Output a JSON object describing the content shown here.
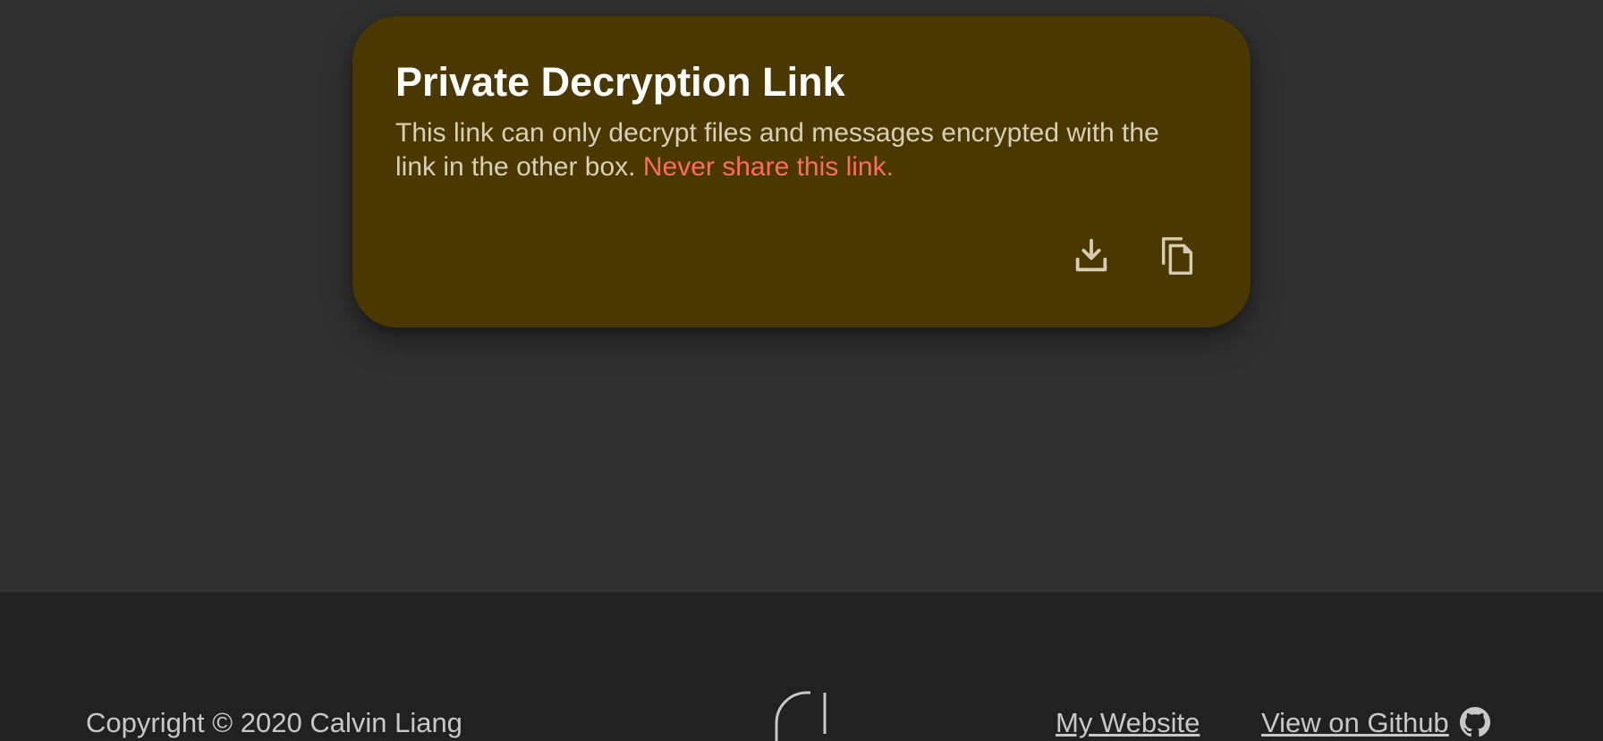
{
  "colors": {
    "page_background": "#303030",
    "card_background": "#4a3800",
    "card_title": "#ffffff",
    "card_text": "#d8cfb8",
    "warning_text": "#ff6b5e",
    "icon": "#d6ccb4",
    "footer_background": "#212121",
    "footer_text": "#c8c8c8"
  },
  "card": {
    "title": "Private Decryption Link",
    "description": "This link can only decrypt files and messages encrypted with the link in the other box.",
    "warning": "Never share this link.",
    "actions": [
      {
        "icon": "download-icon"
      },
      {
        "icon": "copy-icon"
      }
    ]
  },
  "footer": {
    "copyright": "Copyright © 2020 Calvin Liang",
    "logo_icon": "logo-mark",
    "links": [
      {
        "label": "My Website"
      },
      {
        "label": "View on Github",
        "icon": "github-icon"
      }
    ]
  }
}
